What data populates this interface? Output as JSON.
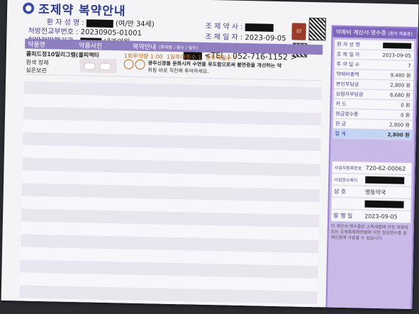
{
  "header": {
    "title": "조제약 복약안내",
    "icon": "pill-icon"
  },
  "patient": {
    "name_label": "환 자 성 명 :",
    "name_suffix": "(여/만 34세)",
    "rx_label": "처방전교부번호 :",
    "rx_value": "20230905-01001",
    "issuer_label": "처방전발행기관 :",
    "issuer_value": "내과의원",
    "pharmacist_label": "조 제 약 사 :",
    "date_label": "조 제 일 자 :",
    "date_value": "2023-09-05",
    "tel_label": "<TEL :",
    "tel_value": "052-716-1152 >"
  },
  "table_headers": {
    "drug": "약품명",
    "photo": "약품사진",
    "guide": "복약안내",
    "guide_sub": "(투약량 / 횟수 / 일수)"
  },
  "drug": {
    "name": "콜피드정10밀리그램(콜피맥타",
    "form1": "흰색 정제",
    "form2": "실온보관",
    "dose_once": "1회투약량 1.00",
    "dose_times": "1일투여횟수 1",
    "dose_days": "총투약일수 7",
    "desc1": "광주신경을 둔화시켜 수면을 유도함으로써 불면증을 개선하는 약",
    "desc2": "취침 바로 직전에 투여하세요."
  },
  "receipt": {
    "title": "약제비 계산서·영수증",
    "subtitle": "[환자 제출용]",
    "rows": [
      {
        "k": "환 자 성 명",
        "v": ""
      },
      {
        "k": "조 제 일 자",
        "v": "2023-09-05"
      },
      {
        "k": "투 약 일 수",
        "v": "7"
      },
      {
        "k": "약제비총액",
        "v": "9,480 원"
      },
      {
        "k": "본인부담금",
        "v": "2,800 원"
      },
      {
        "k": "보험자부담금",
        "v": "6,680 원"
      },
      {
        "k": "카 드",
        "v": "0 원"
      },
      {
        "k": "현금영수증",
        "v": "0 원"
      },
      {
        "k": "현 금",
        "v": "2,800 원"
      }
    ],
    "total_label": "합 계",
    "total_value": "2,800 원",
    "biz_no_label": "사업자등록번호",
    "biz_no": "720-62-00062",
    "addr_label": "사업장소재지",
    "store_label": "상 호",
    "store_value": "명동약국",
    "issue_label": "발 행 일",
    "issue_date": "2023-09-05",
    "note": "이 계산서·영수증은 소득세법에 의한 의료비 또는 조세특례제한법에 의한 현금영수증 공제신청에 사용할 수 있습니다."
  }
}
